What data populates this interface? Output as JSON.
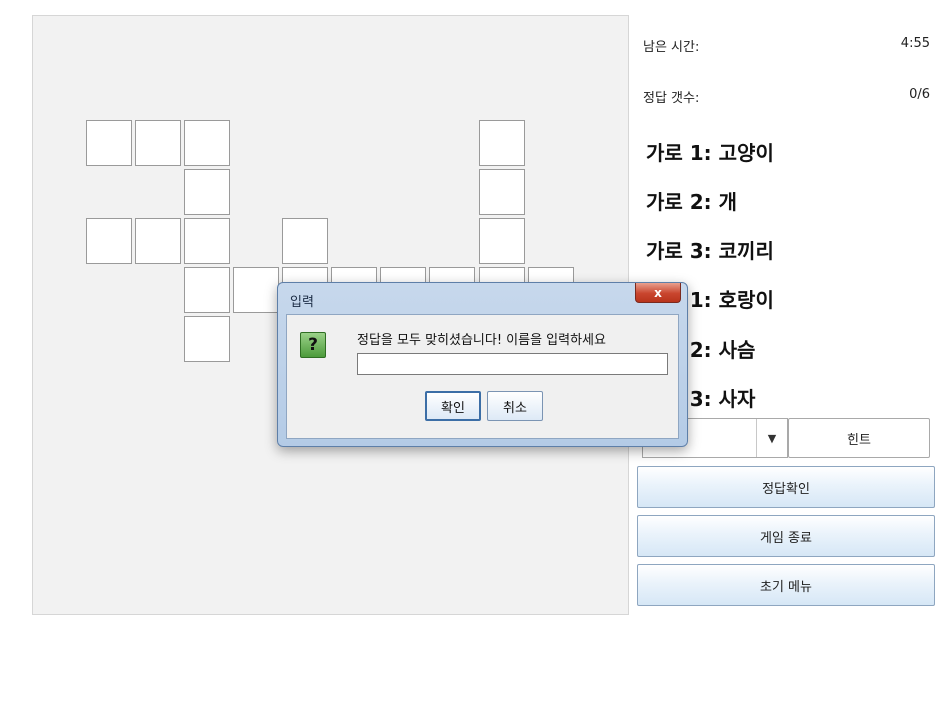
{
  "status": {
    "time_label": "남은 시간:",
    "time_value": "4:55",
    "correct_label": "정답 갯수:",
    "correct_value": "0/6"
  },
  "clues": [
    "가로 1: 고양이",
    "가로 2: 개",
    "가로 3: 코끼리",
    "세로 1: 호랑이",
    "세로 2: 사슴",
    "세로 3: 사자"
  ],
  "controls": {
    "hint_select_value": "",
    "hint_button": "힌트",
    "check_button": "정답확인",
    "quit_button": "게임 종료",
    "menu_button": "초기 메뉴"
  },
  "dialog": {
    "title": "입력",
    "close_symbol": "x",
    "icon_symbol": "?",
    "message": "정답을 모두 맞히셨습니다! 이름을 입력하세요",
    "input_value": "",
    "ok_button": "확인",
    "cancel_button": "취소"
  },
  "colors": {
    "button_border": "#8ea6c0",
    "dialog_frame": "#b4cbe6",
    "close_button": "#c9452e"
  }
}
